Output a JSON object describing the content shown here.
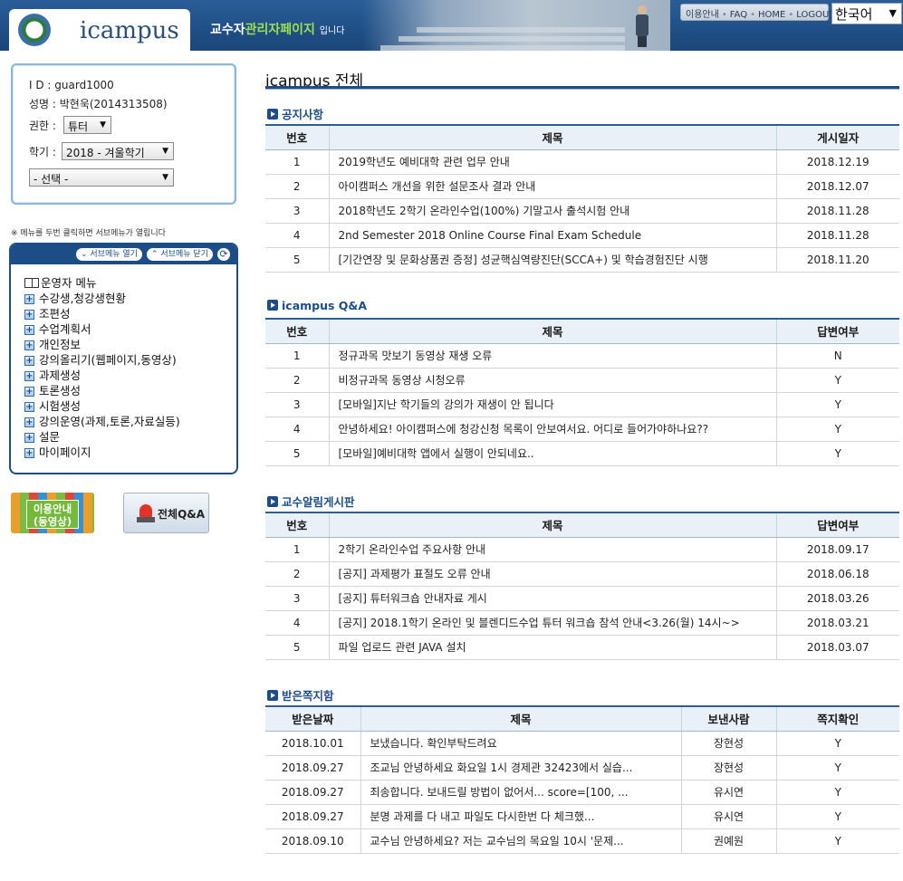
{
  "header": {
    "logo_text": "icampus",
    "slogan_prefix": "교수자",
    "slogan_highlight": "관리자페이지",
    "slogan_suffix": "입니다",
    "top_links": [
      "이용안내",
      "FAQ",
      "HOME",
      "LOGOUT"
    ],
    "language": "한국어"
  },
  "user": {
    "id_line": "I D : guard1000",
    "name_line": "성명 : 박현욱(2014313508)",
    "role_label": "권한 :",
    "role_value": "튜터",
    "term_label": "학기 :",
    "term_value": "2018 - 겨울학기",
    "course_value": "- 선택 -"
  },
  "menu": {
    "hint": "※ 메뉴를 두번 클릭하면 서브메뉴가 열립니다",
    "open_label": "서브메뉴 열기",
    "close_label": "서브메뉴 닫기",
    "root": "운영자 메뉴",
    "items": [
      "수강생,청강생현황",
      "조편성",
      "수업계획서",
      "개인정보",
      "강의올리기(웹페이지,동영상)",
      "과제생성",
      "토론생성",
      "시험생성",
      "강의운영(과제,토론,자료실등)",
      "설문",
      "마이페이지"
    ]
  },
  "side_buttons": {
    "guide": "이용안내\n(동영상)",
    "qna": "전체Q&A"
  },
  "main": {
    "title": "icampus 전체",
    "notice": {
      "title": "공지사항",
      "headers": [
        "번호",
        "제목",
        "게시일자"
      ],
      "rows": [
        [
          "1",
          "2019학년도 예비대학 관련 업무 안내",
          "2018.12.19"
        ],
        [
          "2",
          "아이캠퍼스 개선을 위한 설문조사 결과 안내",
          "2018.12.07"
        ],
        [
          "3",
          "2018학년도 2학기 온라인수업(100%) 기말고사 출석시험 안내",
          "2018.11.28"
        ],
        [
          "4",
          "2nd Semester 2018 Online Course Final Exam Schedule",
          "2018.11.28"
        ],
        [
          "5",
          "[기간연장 및 문화상품권 증정] 성균핵심역량진단(SCCA+) 및 학습경험진단 시행",
          "2018.11.20"
        ]
      ]
    },
    "qna": {
      "title": "icampus Q&A",
      "headers": [
        "번호",
        "제목",
        "답변여부"
      ],
      "rows": [
        [
          "1",
          "정규과목 맛보기 동영상 재생 오류",
          "N"
        ],
        [
          "2",
          "비정규과목 동영상 시청오류",
          "Y"
        ],
        [
          "3",
          "[모바일]지난 학기들의 강의가 재생이 안 됩니다",
          "Y"
        ],
        [
          "4",
          "안녕하세요! 아이캠퍼스에 청강신청 목록이 안보여서요. 어디로 들어가야하나요??",
          "Y"
        ],
        [
          "5",
          "[모바일]예비대학 앱에서 실행이 안되네요..",
          "Y"
        ]
      ]
    },
    "board": {
      "title": "교수알림게시판",
      "headers": [
        "번호",
        "제목",
        "답변여부"
      ],
      "rows": [
        [
          "1",
          "2학기 온라인수업 주요사항 안내",
          "2018.09.17"
        ],
        [
          "2",
          "[공지] 과제평가 표절도 오류 안내",
          "2018.06.18"
        ],
        [
          "3",
          "[공지] 튜터워크숍 안내자료 게시",
          "2018.03.26"
        ],
        [
          "4",
          "[공지] 2018.1학기 온라인 및 블렌디드수업 튜터 워크숍 참석 안내<3.26(월) 14시~>",
          "2018.03.21"
        ],
        [
          "5",
          "파일 업로드 관련 JAVA 설치",
          "2018.03.07"
        ]
      ]
    },
    "inbox": {
      "title": "받은쪽지함",
      "headers": [
        "받은날짜",
        "제목",
        "보낸사람",
        "쪽지확인"
      ],
      "rows": [
        [
          "2018.10.01",
          "보냈습니다. 확인부탁드려요",
          "장현성",
          "Y"
        ],
        [
          "2018.09.27",
          "조교님 안녕하세요 화요일 1시 경제관 32423에서 실습...",
          "장현성",
          "Y"
        ],
        [
          "2018.09.27",
          "죄송합니다. 보내드릴 방법이 없어서... score=[100, ...",
          "유시연",
          "Y"
        ],
        [
          "2018.09.27",
          "분명 과제를 다 내고 파일도 다시한번 다 체크했...",
          "유시연",
          "Y"
        ],
        [
          "2018.09.10",
          "교수님 안녕하세요? 저는 교수님의 목요일 10시 '문제...",
          "권예원",
          "Y"
        ]
      ]
    }
  }
}
